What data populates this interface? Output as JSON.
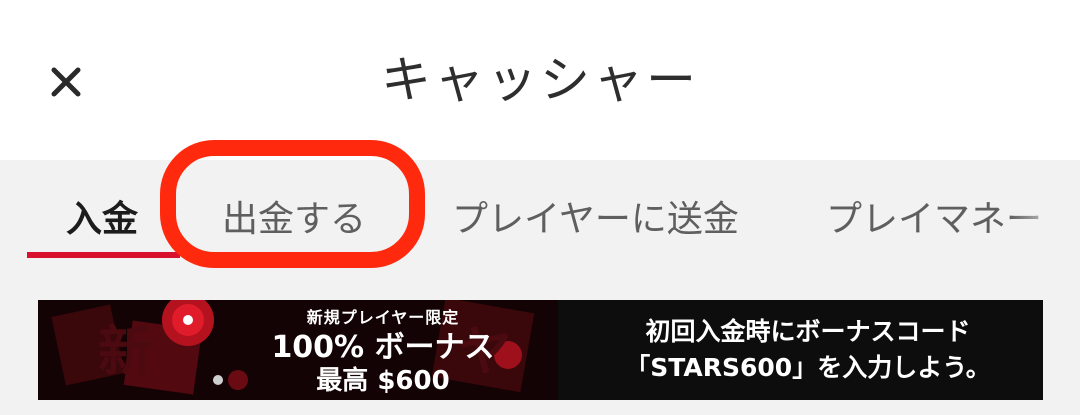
{
  "header": {
    "title": "キャッシャー",
    "close_icon": "close-icon"
  },
  "tabs": [
    {
      "label": "入金",
      "active": true
    },
    {
      "label": "出金する",
      "active": false
    },
    {
      "label": "プレイヤーに送金",
      "active": false
    },
    {
      "label": "プレイマネー",
      "active": false
    }
  ],
  "colors": {
    "accent": "#d8112c",
    "highlight": "#ff2a0d",
    "tab_bar_bg": "#f2f2f2",
    "banner_bg": "#0d0d0d"
  },
  "banner": {
    "line1": "新規プレイヤー限定",
    "line2": "100% ボーナス",
    "line3": "最高 $600",
    "right_line1": "初回入金時にボーナスコード",
    "right_line2": "「STARS600」を入力しよう。"
  }
}
